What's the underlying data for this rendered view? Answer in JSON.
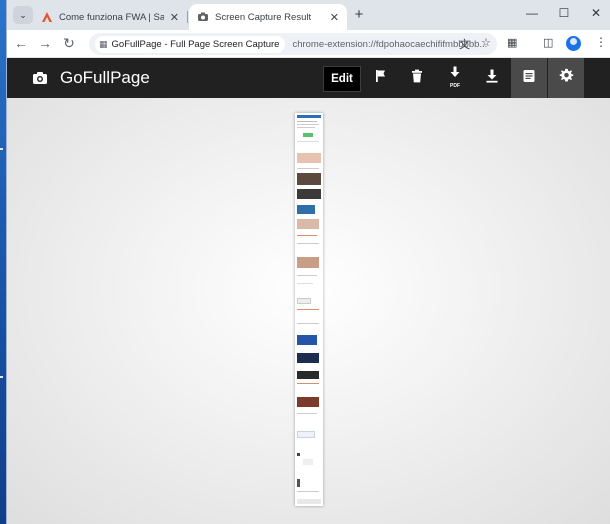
{
  "browser": {
    "tabs": [
      {
        "title": "Come funziona FWA | Salvatore",
        "active": false
      },
      {
        "title": "Screen Capture Result",
        "active": true
      }
    ],
    "address": {
      "site_chip": "GoFullPage - Full Page Screen Capture",
      "url": "chrome-extension://fdpohaocaechififmbbbbb..."
    }
  },
  "app": {
    "name": "GoFullPage",
    "edit_label": "Edit",
    "toolbar_icons": [
      "flag-icon",
      "trash-icon",
      "download-pdf-icon",
      "download-icon",
      "notes-icon",
      "settings-icon"
    ],
    "pdf_badge": "PDF",
    "bar_color": "#212121"
  },
  "capture": {
    "thumbnail": "full-page-screenshot-preview"
  }
}
